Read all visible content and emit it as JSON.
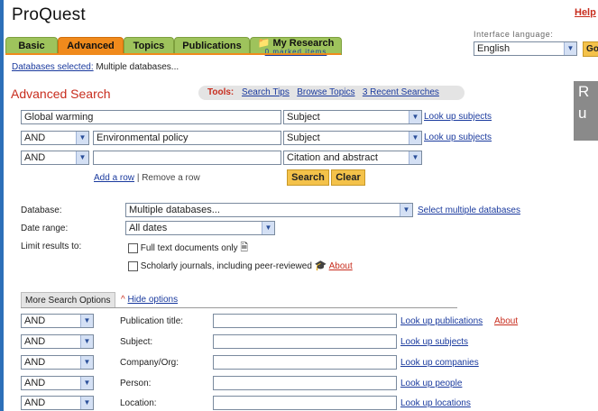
{
  "header": {
    "logo": "ProQuest",
    "help": "Help",
    "tabs": [
      "Basic",
      "Advanced",
      "Topics",
      "Publications"
    ],
    "my_research": {
      "label": "My Research",
      "sub": "0 marked items"
    },
    "interface_language_label": "Interface language:",
    "interface_language_value": "English",
    "go": "Go"
  },
  "databases_selected": {
    "link": "Databases selected:",
    "value": "Multiple databases..."
  },
  "page_title": "Advanced Search",
  "tools": {
    "label": "Tools:",
    "links": [
      "Search Tips",
      "Browse Topics",
      "3 Recent Searches"
    ]
  },
  "search_rows": [
    {
      "operator": "",
      "term": "Global warming",
      "field": "Subject",
      "lookup": "Look up subjects"
    },
    {
      "operator": "AND",
      "term": "Environmental policy",
      "field": "Subject",
      "lookup": "Look up subjects"
    },
    {
      "operator": "AND",
      "term": "",
      "field": "Citation and abstract",
      "lookup": ""
    }
  ],
  "row_actions": {
    "add": "Add a row",
    "separator": "|",
    "remove": "Remove a row"
  },
  "buttons": {
    "search": "Search",
    "clear": "Clear"
  },
  "filters": {
    "database_label": "Database:",
    "database_value": "Multiple databases...",
    "database_link": "Select multiple databases",
    "date_label": "Date range:",
    "date_value": "All dates",
    "limit_label": "Limit results to:",
    "fulltext": "Full text documents only",
    "scholarly": "Scholarly journals, including peer-reviewed",
    "about": "About"
  },
  "more_options": {
    "tab": "More Search Options",
    "hide": "Hide options",
    "rows": [
      {
        "operator": "AND",
        "label": "Publication title:",
        "link": "Look up publications",
        "extra": "About"
      },
      {
        "operator": "AND",
        "label": "Subject:",
        "link": "Look up subjects",
        "extra": ""
      },
      {
        "operator": "AND",
        "label": "Company/Org:",
        "link": "Look up companies",
        "extra": ""
      },
      {
        "operator": "AND",
        "label": "Person:",
        "link": "Look up people",
        "extra": ""
      },
      {
        "operator": "AND",
        "label": "Location:",
        "link": "Look up locations",
        "extra": ""
      }
    ]
  },
  "side_promo": {
    "line1": "R",
    "line2": "u"
  },
  "icons": {
    "fulltext": "document-icon",
    "scholarly": "mortarboard-icon",
    "dropdown": "chevron-down-icon"
  },
  "colors": {
    "accent_orange": "#f08a1c",
    "tab_green": "#9ec35c",
    "title_red": "#c82d1e",
    "link_blue": "#1a3a9e",
    "button_yellow": "#f4c24a"
  }
}
